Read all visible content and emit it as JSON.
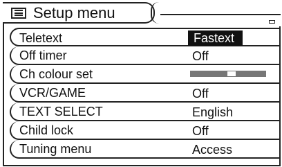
{
  "menu": {
    "title": "Setup menu",
    "items": [
      {
        "label": "Teletext",
        "value": "Fastext",
        "selected": true
      },
      {
        "label": "Off timer",
        "value": "Off"
      },
      {
        "label": "Ch colour set",
        "value": "",
        "slider_level": 0.55
      },
      {
        "label": "VCR/GAME",
        "value": "Off"
      },
      {
        "label": "TEXT SELECT",
        "value": "English"
      },
      {
        "label": "Child lock",
        "value": "Off"
      },
      {
        "label": "Tuning menu",
        "value": "Access"
      }
    ]
  }
}
